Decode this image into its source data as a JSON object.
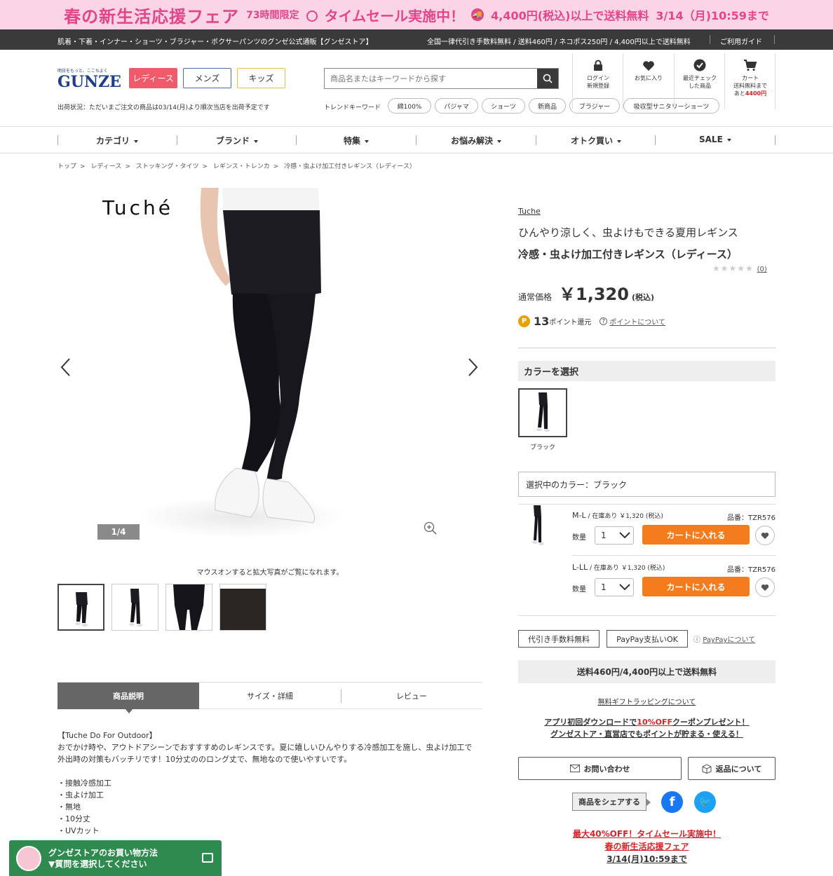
{
  "promo": {
    "title": "春の新生活応援フェア",
    "limited": "73時間限定",
    "sale": "タイムセール実施中！",
    "free_shipping": "4,400円(税込)以上で送料無料",
    "until": "3/14（月)10:59まで"
  },
  "topbar": {
    "tagline": "肌着・下着・インナー・ショーツ・ブラジャー・ボクサーパンツのグンゼ公式通販【グンゼストア】",
    "shipping_info": "全国一律代引き手数料無料 / 送料460円 / ネコポス250円 / 4,400円以上で送料無料",
    "guide": "ご利用ガイド"
  },
  "header": {
    "logo_tag": "明日をもっと、ここちよく",
    "logo_word": "GUNZE",
    "gender_buttons": [
      "レディース",
      "メンズ",
      "キッズ"
    ],
    "ship_status": "出荷状況：ただいまご注文の商品は03/14(月)より順次当店を出荷予定です",
    "search_placeholder": "商品名またはキーワードから探す",
    "trend_label": "トレンドキーワード",
    "trends": [
      "綿100%",
      "パジャマ",
      "ショーツ",
      "新商品",
      "ブラジャー",
      "吸収型サニタリーショーツ"
    ],
    "icons": {
      "login": [
        "ログイン",
        "新規登録"
      ],
      "fav": "お気に入り",
      "recent": [
        "最近チェック",
        "した商品"
      ],
      "cart": "カート",
      "cart_note": "送料無料まで",
      "cart_remain_prefix": "あと",
      "cart_remain": "4400円"
    }
  },
  "nav": [
    "カテゴリ",
    "ブランド",
    "特集",
    "お悩み解決",
    "オトク買い",
    "SALE"
  ],
  "breadcrumb": [
    "トップ",
    "レディース",
    "ストッキング・タイツ",
    "レギンス・トレンカ",
    "冷感・虫よけ加工付きレギンス（レディース）"
  ],
  "gallery": {
    "brand_overlay": "Tuché",
    "counter": "1/4",
    "zoom_note": "マウスオンすると拡大写真がご覧になれます。"
  },
  "tabs": [
    "商品説明",
    "サイズ・詳細",
    "レビュー"
  ],
  "description": {
    "heading": "【Tuche Do For Outdoor】",
    "body": [
      "おでかけ時や、アウトドアシーンでおすすすめのレギンスです。夏に嬉しいひんやりする冷感加工を施し、虫よけ加工で",
      "外出時の対策もバッチリです！10分丈ののロング丈で、無地なので使いやすいです。"
    ],
    "features": [
      "・接触冷感加工",
      "・虫よけ加工",
      "・無地",
      "・10分丈",
      "・UVカット"
    ]
  },
  "product": {
    "brand": "Tuche",
    "catch": "ひんやり涼しく、虫よけもできる夏用レギンス",
    "name": "冷感・虫よけ加工付きレギンス（レディース）",
    "stars": "★★★★★",
    "review_count": "(0)",
    "price_label": "通常価格",
    "price": "￥1,320",
    "tax": "(税込)",
    "points": "13",
    "points_unit": "ポイント還元",
    "points_link": "ポイントについて",
    "color_head": "カラーを選択",
    "color_name": "ブラック",
    "selected_color": "選択中のカラー：ブラック",
    "skus": [
      {
        "size": "M-L",
        "stock": " / 在庫あり ￥1,320 (税込)",
        "code": "品番：TZR576",
        "qty_label": "数量",
        "qty": "1",
        "button": "カートに入れる"
      },
      {
        "size": "L-LL",
        "stock": " / 在庫あり ￥1,320 (税込)",
        "code": "品番：TZR576",
        "qty_label": "数量",
        "qty": "1",
        "button": "カートに入れる"
      }
    ],
    "badges": [
      "代引き手数料無料",
      "PayPay支払いOK"
    ],
    "paypay_link": "PayPayについて",
    "ship_box": "送料460円/4,400円以上で送料無料",
    "gift": "無料ギフトラッピングについて",
    "app_1a": "アプリ初回ダウンロードで",
    "app_1b": "10%OFF",
    "app_1c": "クーポンプレゼント！",
    "app_2": "グンゼストア・直営店でもポイントが貯まる・使える！",
    "contact": "お問い合わせ",
    "returns": "返品について",
    "share": "商品をシェアする",
    "timesale_1": "最大40%OFF！タイムセール実施中！",
    "timesale_2": "春の新生活応援フェア",
    "timesale_3": "3/14(月)10:59まで"
  },
  "help": {
    "line1": "グンゼストアのお買い物方法",
    "line2": "▼質問を選択してください"
  },
  "colors": {
    "accent_orange": "#f47c1d",
    "promo_pink": "#e2458a",
    "sale_red": "#d8222a",
    "help_green": "#2e8a4e"
  }
}
